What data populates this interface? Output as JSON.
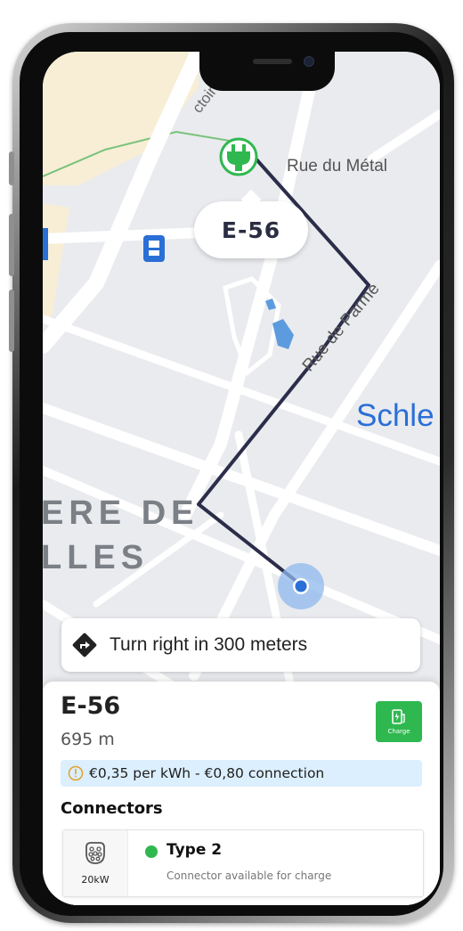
{
  "map": {
    "street_labels": [
      "Rue du Métal",
      "Rue de Parme",
      "ctoire"
    ],
    "district_label_line1": "ERE DE",
    "district_label_line2": "LLES",
    "area_label": "Schle"
  },
  "route_marker": {
    "label": "E-56"
  },
  "navigation": {
    "instruction": "Turn right in 300 meters"
  },
  "station": {
    "name": "E-56",
    "distance": "695 m",
    "charge_label": "Charge",
    "price_info": "€0,35 per kWh - €0,80 connection",
    "connectors_title": "Connectors",
    "connectors": [
      {
        "power": "20kW",
        "type": "Type 2",
        "status": "Connector available for charge",
        "status_color": "#2fb84f"
      }
    ]
  },
  "colors": {
    "route": "#2b2d4a",
    "accent_green": "#2fb84f",
    "price_banner_bg": "#dcefff",
    "transit_blue": "#2a6fd6"
  }
}
